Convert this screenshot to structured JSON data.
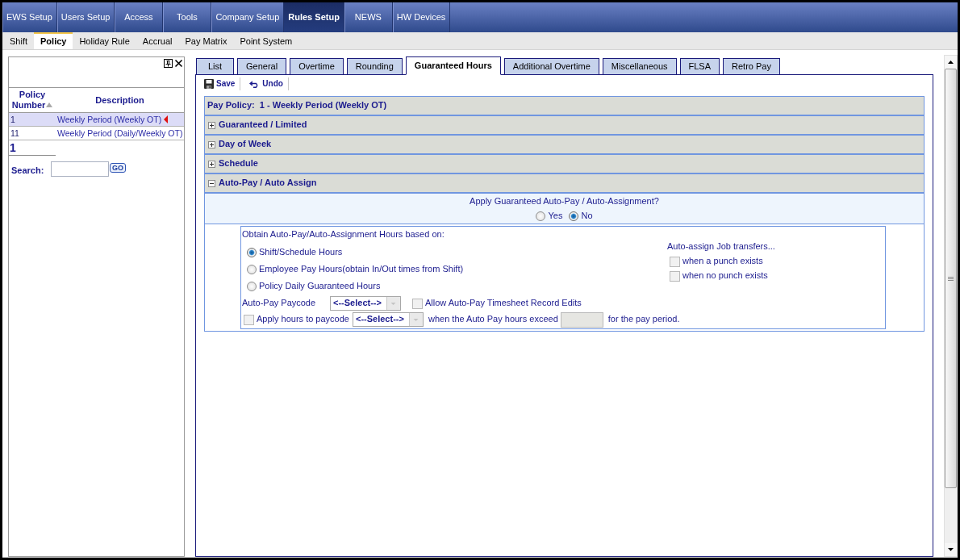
{
  "top_nav": [
    {
      "label": "EWS Setup",
      "selected": false
    },
    {
      "label": "Users Setup",
      "selected": false
    },
    {
      "label": "Access",
      "selected": false
    },
    {
      "label": "Tools",
      "selected": false
    },
    {
      "label": "Company Setup",
      "selected": false
    },
    {
      "label": "Rules Setup",
      "selected": true
    },
    {
      "label": "NEWS",
      "selected": false
    },
    {
      "label": "HW Devices",
      "selected": false
    }
  ],
  "sub_nav": [
    {
      "label": "Shift",
      "selected": false
    },
    {
      "label": "Policy",
      "selected": true
    },
    {
      "label": "Holiday Rule",
      "selected": false
    },
    {
      "label": "Accrual",
      "selected": false
    },
    {
      "label": "Pay Matrix",
      "selected": false
    },
    {
      "label": "Point System",
      "selected": false
    }
  ],
  "policy_list": {
    "columns": [
      {
        "label": "Policy Number",
        "sorted": true
      },
      {
        "label": "Description",
        "sorted": false
      }
    ],
    "rows": [
      {
        "number": "1",
        "description": "Weekly Period (Weekly OT)",
        "selected": true
      },
      {
        "number": "11",
        "description": "Weekly Period (Daily/Weekly OT)",
        "selected": false
      }
    ],
    "pages": [
      {
        "label": "1",
        "selected": true
      }
    ],
    "search": {
      "label": "Search:",
      "button": "GO"
    }
  },
  "tabs": [
    {
      "label": "List",
      "selected": false
    },
    {
      "label": "General",
      "selected": false
    },
    {
      "label": "Overtime",
      "selected": false
    },
    {
      "label": "Rounding",
      "selected": false
    },
    {
      "label": "Guaranteed Hours",
      "selected": true
    },
    {
      "label": "Additional Overtime",
      "selected": false
    },
    {
      "label": "Miscellaneous",
      "selected": false
    },
    {
      "label": "FLSA",
      "selected": false
    },
    {
      "label": "Retro Pay",
      "selected": false
    }
  ],
  "toolbar": [
    {
      "kind": "save",
      "label": "Save"
    },
    {
      "kind": "undo",
      "label": "Undo"
    }
  ],
  "policy_header": "Pay Policy:  1 - Weekly Period (Weekly OT)",
  "sections": [
    {
      "title": "Guaranteed / Limited",
      "expanded": false
    },
    {
      "title": "Day of Week",
      "expanded": false
    },
    {
      "title": "Schedule",
      "expanded": false
    },
    {
      "title": "Auto-Pay / Auto Assign",
      "expanded": true,
      "content": {
        "question": "Apply Guaranteed Auto-Pay / Auto-Assignment?",
        "answers": [
          {
            "label": "Yes",
            "selected": false
          },
          {
            "label": "No",
            "selected": true
          }
        ],
        "basis_label": "Obtain Auto-Pay/Auto-Assignment Hours based on:",
        "basis_options": [
          {
            "label": "Shift/Schedule Hours",
            "selected": true
          },
          {
            "label": "Employee Pay Hours(obtain In/Out times from Shift)",
            "selected": false
          },
          {
            "label": "Policy Daily Guaranteed Hours",
            "selected": false
          }
        ],
        "job_transfers_label": "Auto-assign Job transfers...",
        "job_transfers": [
          {
            "label": "when a punch exists",
            "checked": false,
            "disabled": true
          },
          {
            "label": "when no punch exists",
            "checked": false,
            "disabled": true
          }
        ],
        "paycode": {
          "label": "Auto-Pay Paycode",
          "value": "<--Select-->",
          "disabled": true
        },
        "allow_edits": {
          "label": "Allow Auto-Pay Timesheet Record Edits",
          "checked": false,
          "disabled": true
        },
        "apply_hours": {
          "label": "Apply hours to paycode",
          "checked": false,
          "disabled": true,
          "paycode": {
            "value": "<--Select-->",
            "disabled": true
          },
          "condition": "when the Auto Pay hours exceed",
          "hours": {
            "disabled": true
          },
          "suffix": "for the pay period."
        }
      }
    }
  ]
}
